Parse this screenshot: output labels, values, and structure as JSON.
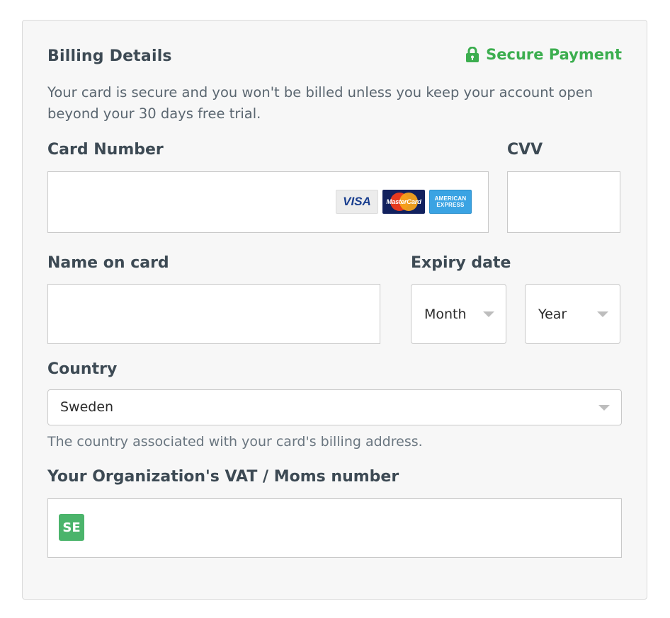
{
  "form": {
    "title": "Billing Details",
    "secure_label": "Secure Payment",
    "intro": "Your card is secure and you won't be billed unless you keep your account open beyond your 30 days free trial."
  },
  "card_number": {
    "label": "Card Number",
    "value": "",
    "brands": {
      "visa": "VISA",
      "mastercard": "MasterCard",
      "amex_line1": "AMERICAN",
      "amex_line2": "EXPRESS"
    }
  },
  "cvv": {
    "label": "CVV",
    "value": ""
  },
  "name_on_card": {
    "label": "Name on card",
    "value": ""
  },
  "expiry": {
    "label": "Expiry date",
    "month": "Month",
    "year": "Year"
  },
  "country": {
    "label": "Country",
    "selected": "Sweden",
    "hint": "The country associated with your card's billing address."
  },
  "vat": {
    "label": "Your Organization's VAT / Moms number",
    "prefix": "SE",
    "value": ""
  },
  "colors": {
    "accent_green": "#3cae4f",
    "badge_green": "#4bb46b",
    "text_dark": "#3d4a54"
  },
  "icons": {
    "secure": "lock-icon",
    "dropdown": "chevron-down-icon"
  }
}
